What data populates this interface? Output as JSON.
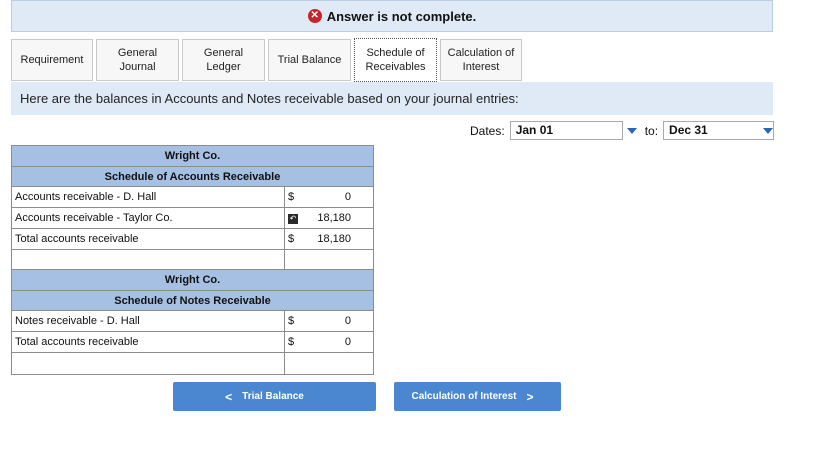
{
  "banner": {
    "icon": "error-x-icon",
    "text": "Answer is not complete."
  },
  "tabs": [
    {
      "line1": "Requirement",
      "line2": ""
    },
    {
      "line1": "General",
      "line2": "Journal"
    },
    {
      "line1": "General",
      "line2": "Ledger"
    },
    {
      "line1": "Trial Balance",
      "line2": ""
    },
    {
      "line1": "Schedule of",
      "line2": "Receivables"
    },
    {
      "line1": "Calculation of",
      "line2": "Interest"
    }
  ],
  "info": "Here are the balances in Accounts and Notes receivable based on your journal entries:",
  "dates": {
    "label": "Dates:",
    "from": "Jan 01",
    "to_label": "to:",
    "to": "Dec 31"
  },
  "accounts_schedule": {
    "company": "Wright Co.",
    "title": "Schedule of Accounts Receivable",
    "rows": [
      {
        "label": "Accounts receivable - D. Hall",
        "currency": "$",
        "value": "0"
      },
      {
        "label": "Accounts receivable - Taylor Co.",
        "currency": "",
        "value": "18,180"
      },
      {
        "label": "Total accounts receivable",
        "currency": "$",
        "value": "18,180"
      }
    ]
  },
  "notes_schedule": {
    "company": "Wright Co.",
    "title": "Schedule of Notes Receivable",
    "rows": [
      {
        "label": "Notes receivable - D. Hall",
        "currency": "$",
        "value": "0"
      },
      {
        "label": "Total accounts receivable",
        "currency": "$",
        "value": "0"
      }
    ]
  },
  "nav": {
    "prev": "Trial Balance",
    "next": "Calculation of Interest"
  },
  "colors": {
    "header_blue": "#a6c0e4",
    "button_blue": "#4b87d0",
    "banner_bg": "#dfeaf6",
    "error_red": "#c8242b"
  }
}
